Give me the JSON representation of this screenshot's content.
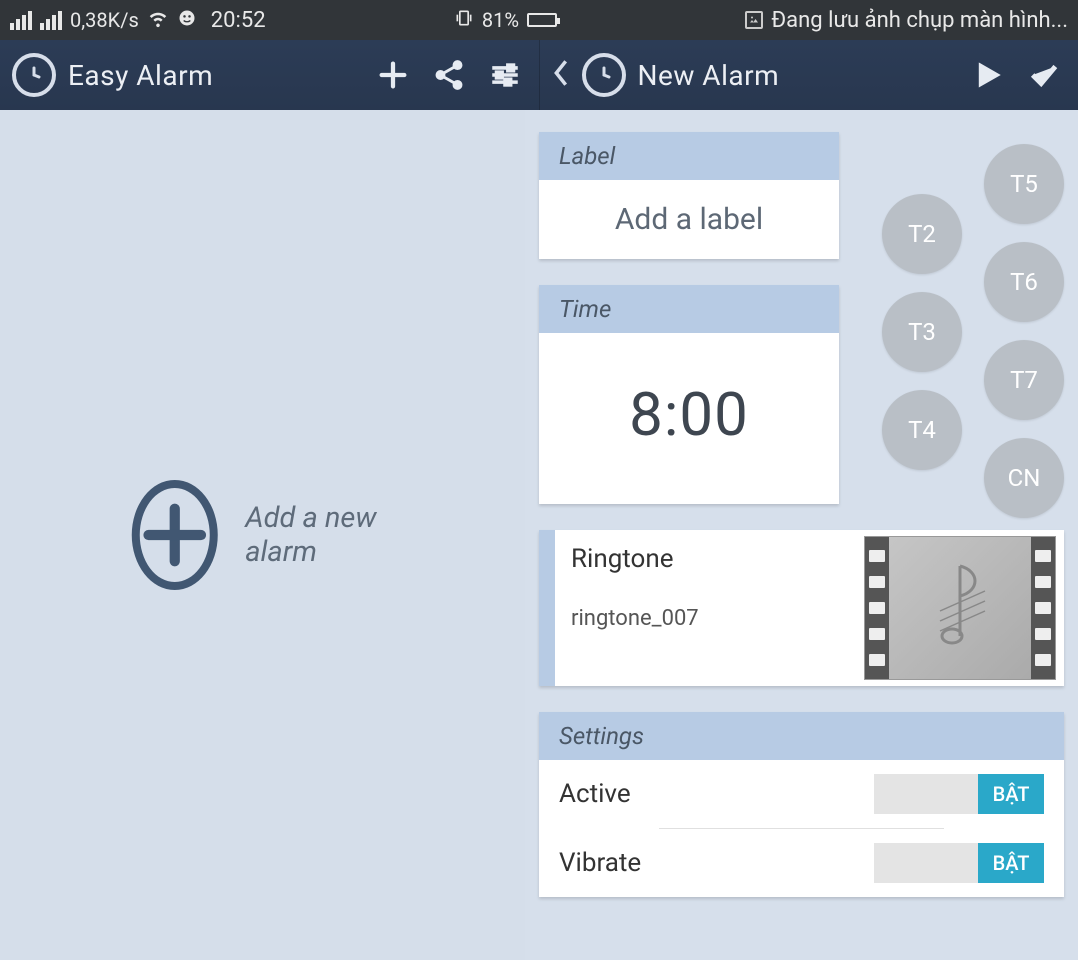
{
  "statusbar": {
    "data_rate": "0,38K/s",
    "time": "20:52",
    "battery_pct": "81%",
    "screenshot_msg": "Đang lưu ảnh chụp màn hình..."
  },
  "left_app": {
    "title": "Easy Alarm",
    "empty_label": "Add a new alarm"
  },
  "right_app": {
    "title": "New Alarm",
    "label_section": "Label",
    "label_placeholder": "Add a label",
    "time_section": "Time",
    "time_value": "8:00",
    "ringtone_title": "Ringtone",
    "ringtone_name": "ringtone_007",
    "settings_section": "Settings",
    "settings": {
      "active_label": "Active",
      "active_toggle": "BẬT",
      "vibrate_label": "Vibrate",
      "vibrate_toggle": "BẬT"
    },
    "days": {
      "t2": "T2",
      "t3": "T3",
      "t4": "T4",
      "t5": "T5",
      "t6": "T6",
      "t7": "T7",
      "cn": "CN"
    }
  }
}
